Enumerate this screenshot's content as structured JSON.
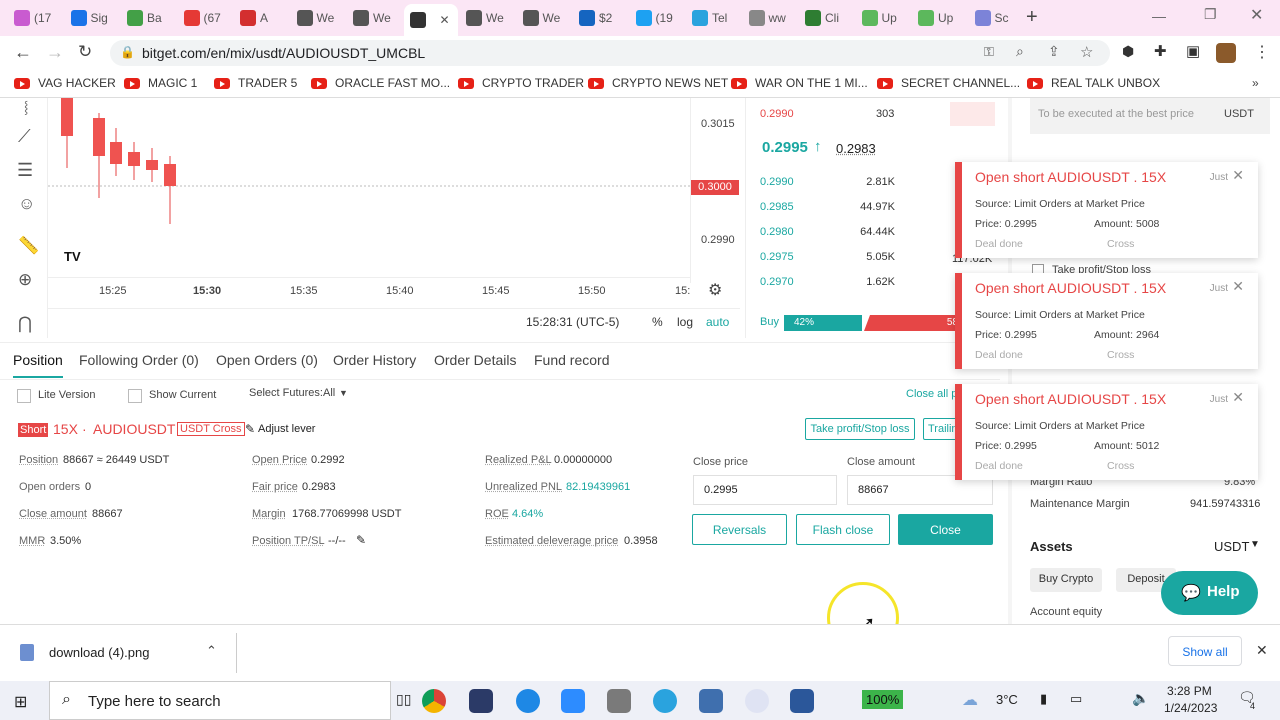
{
  "browser": {
    "tabs": [
      {
        "label": "(17",
        "color": "#c95bd0"
      },
      {
        "label": "Sig",
        "color": "#1a73e8"
      },
      {
        "label": "Ba",
        "color": "#43a047"
      },
      {
        "label": "(67",
        "color": "#e53935"
      },
      {
        "label": "A",
        "color": "#d32f2f"
      },
      {
        "label": "We",
        "color": "#555555"
      },
      {
        "label": "We",
        "color": "#555555"
      },
      {
        "label": "",
        "color": "#333333"
      },
      {
        "label": "We",
        "color": "#555555"
      },
      {
        "label": "We",
        "color": "#555555"
      },
      {
        "label": "$2",
        "color": "#1565c0"
      },
      {
        "label": "(19",
        "color": "#1da1f2"
      },
      {
        "label": "Tel",
        "color": "#2aa3de"
      },
      {
        "label": "ww",
        "color": "#888888"
      },
      {
        "label": "Cli",
        "color": "#2e7d32"
      },
      {
        "label": "Up",
        "color": "#5cb85c"
      },
      {
        "label": "Up",
        "color": "#5cb85c"
      },
      {
        "label": "Sc",
        "color": "#7c83d8"
      }
    ],
    "url": "bitget.com/en/mix/usdt/AUDIOUSDT_UMCBL",
    "bookmarks": [
      "VAG HACKER",
      "MAGIC 1",
      "TRADER 5",
      "ORACLE FAST MO...",
      "CRYPTO TRADER",
      "CRYPTO NEWS NET",
      "WAR ON THE 1 MI...",
      "SECRET CHANNEL...",
      "REAL TALK UNBOX"
    ]
  },
  "chart": {
    "price_axis": [
      "0.3015",
      "0.3000",
      "0.2990"
    ],
    "time_axis": [
      "15:25",
      "15:30",
      "15:35",
      "15:40",
      "15:45",
      "15:50",
      "15:"
    ],
    "clock": "15:28:31 (UTC-5)",
    "pct_label": "%",
    "log_label": "log",
    "auto_label": "auto",
    "tv_logo": "TV"
  },
  "orderbook": {
    "top_ask": {
      "price": "0.2990",
      "amount": "303",
      "total": "303"
    },
    "last_price": "0.2995",
    "mark_price": "0.2983",
    "bids": [
      {
        "price": "0.2990",
        "amount": "2.81K"
      },
      {
        "price": "0.2985",
        "amount": "44.97K"
      },
      {
        "price": "0.2980",
        "amount": "64.44K"
      },
      {
        "price": "0.2975",
        "amount": "5.05K",
        "total": "117.02K"
      },
      {
        "price": "0.2970",
        "amount": "1.62K"
      }
    ],
    "buy_label": "Buy",
    "buy_pct": "42%",
    "sell_pct": "58"
  },
  "tabs": [
    "Position",
    "Following Order (0)",
    "Open Orders (0)",
    "Order History",
    "Order Details",
    "Fund record"
  ],
  "filters": {
    "lite_version": "Lite Version",
    "show_current": "Show Current",
    "select_futures": "Select Futures:All",
    "close_all": "Close all p"
  },
  "position": {
    "side": "Short",
    "leverage": "15X",
    "symbol": "AUDIOUSDT",
    "margin_mode": "USDT Cross",
    "adjust_lever": "Adjust lever",
    "tpsl_button": "Take profit/Stop loss",
    "trailing_button": "Trailin",
    "fields": {
      "position_label": "Position",
      "position_value": "88667 ≈ 26449 USDT",
      "open_orders_label": "Open orders",
      "open_orders_value": "0",
      "close_amount_label": "Close amount",
      "close_amount_value": "88667",
      "mmr_label": "MMR",
      "mmr_value": "3.50%",
      "open_price_label": "Open Price",
      "open_price_value": "0.2992",
      "fair_price_label": "Fair price",
      "fair_price_value": "0.2983",
      "margin_label": "Margin",
      "margin_value": "1768.77069998 USDT",
      "tpsl_label": "Position TP/SL",
      "tpsl_value": "--/--",
      "realized_label": "Realized P&L",
      "realized_value": "0.00000000",
      "unrealized_label": "Unrealized PNL",
      "unrealized_value": "82.19439961",
      "roe_label": "ROE",
      "roe_value": "4.64%",
      "deleverage_label": "Estimated deleverage price",
      "deleverage_value": "0.3958"
    },
    "close_price_label": "Close price",
    "close_price_value": "0.2995",
    "close_amount_input_label": "Close amount",
    "close_amount_input_value": "88667",
    "reversals_button": "Reversals",
    "flash_close_button": "Flash close",
    "close_button": "Close"
  },
  "right_panel": {
    "market_placeholder": "To be executed at the best price",
    "market_unit": "USDT",
    "tpsl_check_label": "Take profit/Stop loss",
    "margin_ratio_label": "Margin Ratio",
    "margin_ratio_value": "9.83%",
    "maintenance_label": "Maintenance Margin",
    "maintenance_value": "941.59743316",
    "assets_label": "Assets",
    "assets_unit": "USDT",
    "buy_crypto": "Buy Crypto",
    "deposit": "Deposit",
    "account_equity": "Account equity",
    "help": "Help"
  },
  "toasts": [
    {
      "title": "Open short AUDIOUSDT . 15X",
      "time": "Just",
      "source": "Source: Limit Orders at Market Price",
      "price": "Price: 0.2995",
      "amount": "Amount: 5008",
      "status": "Deal done",
      "mode": "Cross"
    },
    {
      "title": "Open short AUDIOUSDT . 15X",
      "time": "Just",
      "source": "Source: Limit Orders at Market Price",
      "price": "Price: 0.2995",
      "amount": "Amount: 2964",
      "status": "Deal done",
      "mode": "Cross"
    },
    {
      "title": "Open short AUDIOUSDT . 15X",
      "time": "Just",
      "source": "Source: Limit Orders at Market Price",
      "price": "Price: 0.2995",
      "amount": "Amount: 5012",
      "status": "Deal done",
      "mode": "Cross"
    }
  ],
  "download": {
    "filename": "download (4).png",
    "show_all": "Show all"
  },
  "taskbar": {
    "search_placeholder": "Type here to search",
    "battery": "100%",
    "temp": "3°C",
    "time": "3:28 PM",
    "date": "1/24/2023",
    "notif_count": "4"
  },
  "colors": {
    "accent": "#1aa7a1",
    "short_red": "#e64646",
    "tab_bar": "#fbe6f5"
  }
}
